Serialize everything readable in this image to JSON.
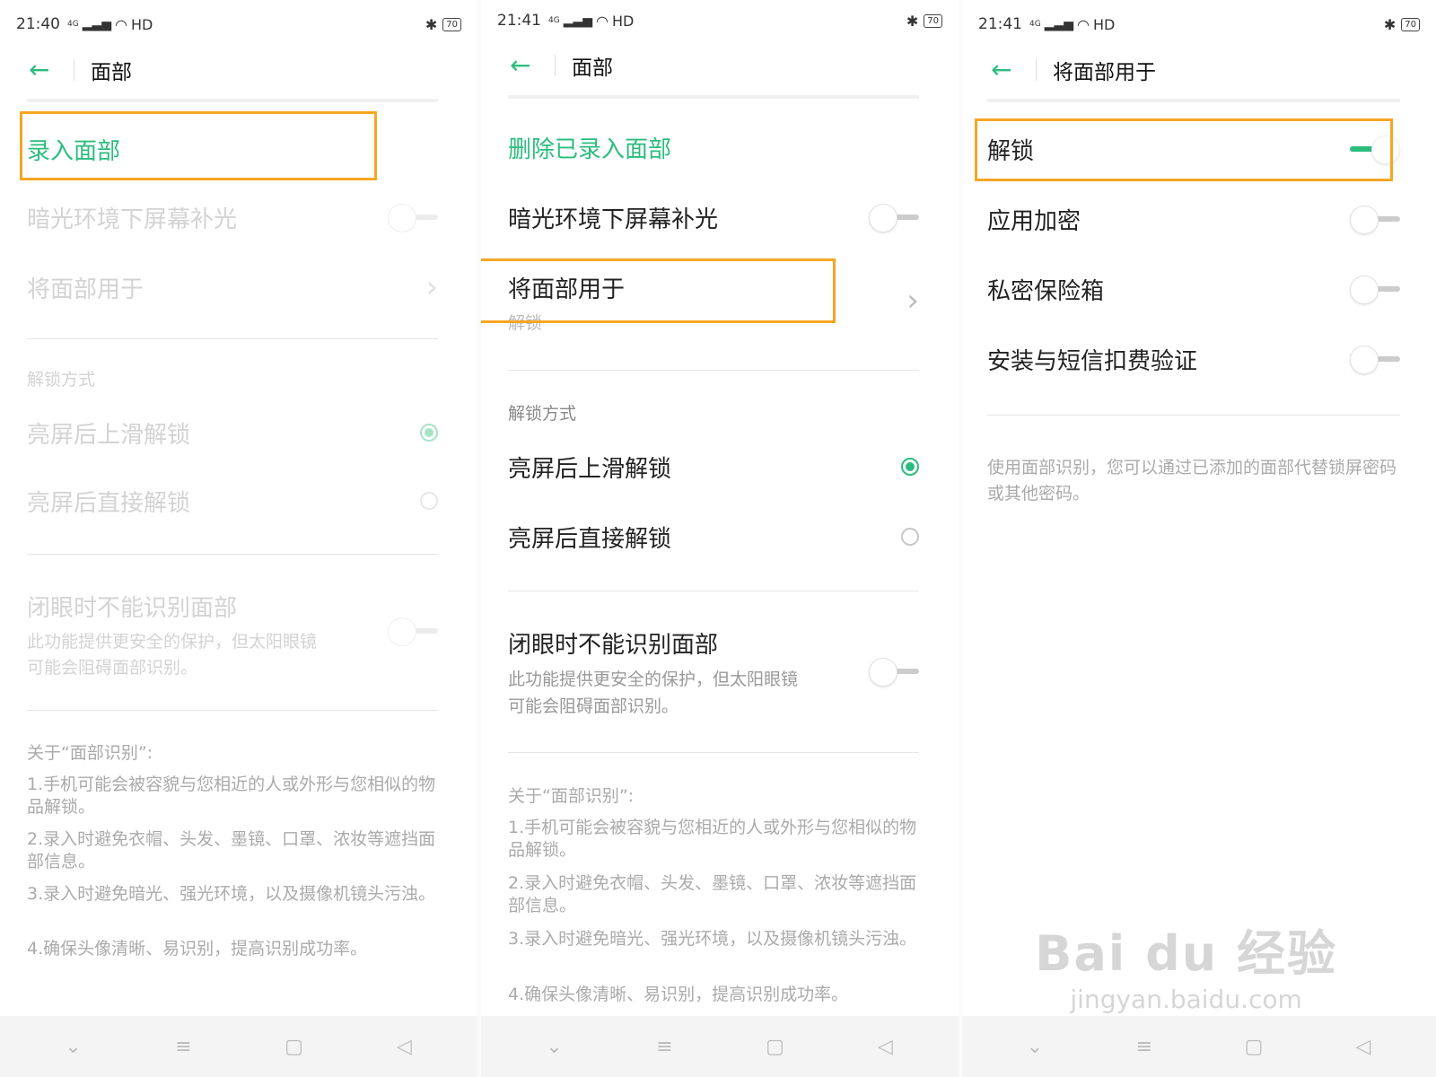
{
  "panel1": {
    "status": {
      "time": "21:40",
      "signal": "4G",
      "network": "HD",
      "battery": "70"
    },
    "header": {
      "title": "面部"
    },
    "enroll": "录入面部",
    "dim_light": "暗光环境下屏幕补光",
    "use_face": "将面部用于",
    "unlock_section": "解锁方式",
    "swipe_unlock": "亮屏后上滑解锁",
    "direct_unlock": "亮屏后直接解锁",
    "eyes_closed": "闭眼时不能识别面部",
    "eyes_closed_desc_1": "此功能提供更安全的保护，但太阳眼镜",
    "eyes_closed_desc_2": "可能会阻碍面部识别。",
    "about_title": "关于“面部识别”:",
    "about": [
      "1.手机可能会被容貌与您相近的人或外形与您相似的物品解锁。",
      "2.录入时避免衣帽、头发、墨镜、口罩、浓妆等遮挡面部信息。",
      "3.录入时避免暗光、强光环境，以及摄像机镜头污浊。",
      "4.确保头像清晰、易识别，提高识别成功率。"
    ]
  },
  "panel2": {
    "status": {
      "time": "21:41",
      "signal": "4G",
      "network": "HD",
      "battery": "70"
    },
    "header": {
      "title": "面部"
    },
    "delete": "删除已录入面部",
    "dim_light": "暗光环境下屏幕补光",
    "use_face": "将面部用于",
    "use_face_sub": "解锁",
    "unlock_section": "解锁方式",
    "swipe_unlock": "亮屏后上滑解锁",
    "direct_unlock": "亮屏后直接解锁",
    "eyes_closed": "闭眼时不能识别面部",
    "eyes_closed_desc_1": "此功能提供更安全的保护，但太阳眼镜",
    "eyes_closed_desc_2": "可能会阻碍面部识别。",
    "about_title": "关于“面部识别”:",
    "about": [
      "1.手机可能会被容貌与您相近的人或外形与您相似的物品解锁。",
      "2.录入时避免衣帽、头发、墨镜、口罩、浓妆等遮挡面部信息。",
      "3.录入时避免暗光、强光环境，以及摄像机镜头污浊。",
      "4.确保头像清晰、易识别，提高识别成功率。"
    ]
  },
  "panel3": {
    "status": {
      "time": "21:41",
      "signal": "4G",
      "network": "HD",
      "battery": "70"
    },
    "header": {
      "title": "将面部用于"
    },
    "unlock": "解锁",
    "app_encrypt": "应用加密",
    "private_safe": "私密保险箱",
    "install_sms": "安装与短信扣费验证",
    "desc": "使用面部识别，您可以通过已添加的面部代替锁屏密码或其他密码。"
  },
  "watermark": {
    "brand": "Bai du 经验",
    "url": "jingyan.baidu.com"
  },
  "colors": {
    "accent": "#2bbd7e",
    "highlight": "#f5a623"
  }
}
